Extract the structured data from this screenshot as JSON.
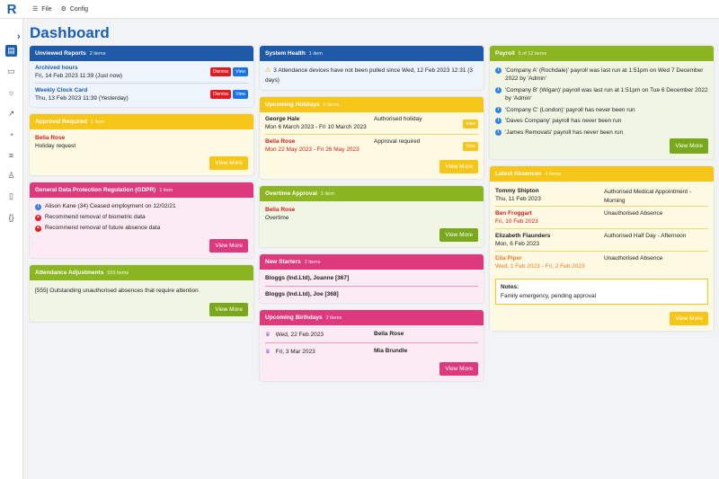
{
  "topbar": {
    "logo": "R",
    "file": "File",
    "config": "Config"
  },
  "page": {
    "title": "Dashboard"
  },
  "unviewed": {
    "title": "Unviewed Reports",
    "count": "2 items",
    "items": [
      {
        "name": "Archived hours",
        "date": "Fri, 14 Feb 2023 11:39 (Just now)"
      },
      {
        "name": "Weekly Clock Card",
        "date": "Thu, 13 Feb 2023 11:39 (Yesterday)"
      }
    ],
    "dismiss": "Dismiss",
    "view": "View"
  },
  "approval": {
    "title": "Approval Required",
    "count": "1 item",
    "name": "Bella Rose",
    "desc": "Holiday request",
    "btn": "View More"
  },
  "gdpr": {
    "title": "General Data Protection Regulation (GDPR)",
    "count": "1 item",
    "items": [
      "Alison Kane (34) Ceased employment on 12/02/21",
      "Recommend removal of biometric data",
      "Recommend removal of future absence data"
    ],
    "btn": "View More"
  },
  "attendance": {
    "title": "Attendance Adjustments",
    "count": "555 items",
    "text": "[555] Outstanding unauthorised absences that require attention",
    "btn": "View More"
  },
  "health": {
    "title": "System Health",
    "count": "1 item",
    "text": "3 Attendance devices have not been pulled since Wed, 12 Feb 2023 12:31 (3 days)"
  },
  "holidays": {
    "title": "Upcoming Holidays",
    "count": "2 items",
    "items": [
      {
        "name": "George Hale",
        "dates": "Mon 6 March 2023 - Fri 10 March 2023",
        "status": "Authorised holiday"
      },
      {
        "name": "Bella Rose",
        "dates": "Mon 22 May 2023 - Fri 26 May 2023",
        "status": "Approval required"
      }
    ],
    "view": "View",
    "btn": "View More"
  },
  "overtime": {
    "title": "Overtime Approval",
    "count": "1 item",
    "name": "Bella Rose",
    "desc": "Overtime",
    "btn": "View More"
  },
  "starters": {
    "title": "New Starters",
    "count": "2 items",
    "items": [
      "Bloggs (Ind.Ltd), Joanne [367]",
      "Bloggs (Ind.Ltd), Joe [368]"
    ]
  },
  "birthdays": {
    "title": "Upcoming Birthdays",
    "count": "2 items",
    "items": [
      {
        "date": "Wed, 22 Feb 2023",
        "name": "Bella Rose"
      },
      {
        "date": "Fri, 3 Mar 2023",
        "name": "Mia Brundle"
      }
    ],
    "btn": "View More"
  },
  "payroll": {
    "title": "Payroll",
    "count": "5 of 12 items",
    "items": [
      "'Company A' (Rochdale)' payroll was last run at 1:51pm on Wed 7 December 2022 by 'Admin'",
      "'Company B' (Wigan)' payroll was last run at 1:51pm on Tue 6 December 2022 by 'Admin'",
      "'Company C' (London)' payroll has never been run",
      "'Daves Company' payroll has never been run",
      "'James Removals' payroll has never been run"
    ],
    "btn": "View More"
  },
  "absences": {
    "title": "Latest Absences",
    "count": "4 items",
    "items": [
      {
        "name": "Tommy Shipton",
        "date": "Thu, 11 Feb 2023",
        "type": "Authorised Medical Appointment - Morning",
        "color": "dark"
      },
      {
        "name": "Ben Froggart",
        "date": "Fri, 10 Feb 2023",
        "type": "Unauthorised Absence",
        "color": "red"
      },
      {
        "name": "Elizabeth Flaunders",
        "date": "Mon, 6 Feb 2023",
        "type": "Authorised Half Day - Afternoon",
        "color": "dark"
      },
      {
        "name": "Ella Piper",
        "date": "Wed, 1 Feb 2023 - Fri, 2 Feb 2023",
        "type": "Unauthorised Absence",
        "color": "orange"
      }
    ],
    "notes_label": "Notes:",
    "notes_text": "Family emergency, pending approval",
    "btn": "View More"
  }
}
